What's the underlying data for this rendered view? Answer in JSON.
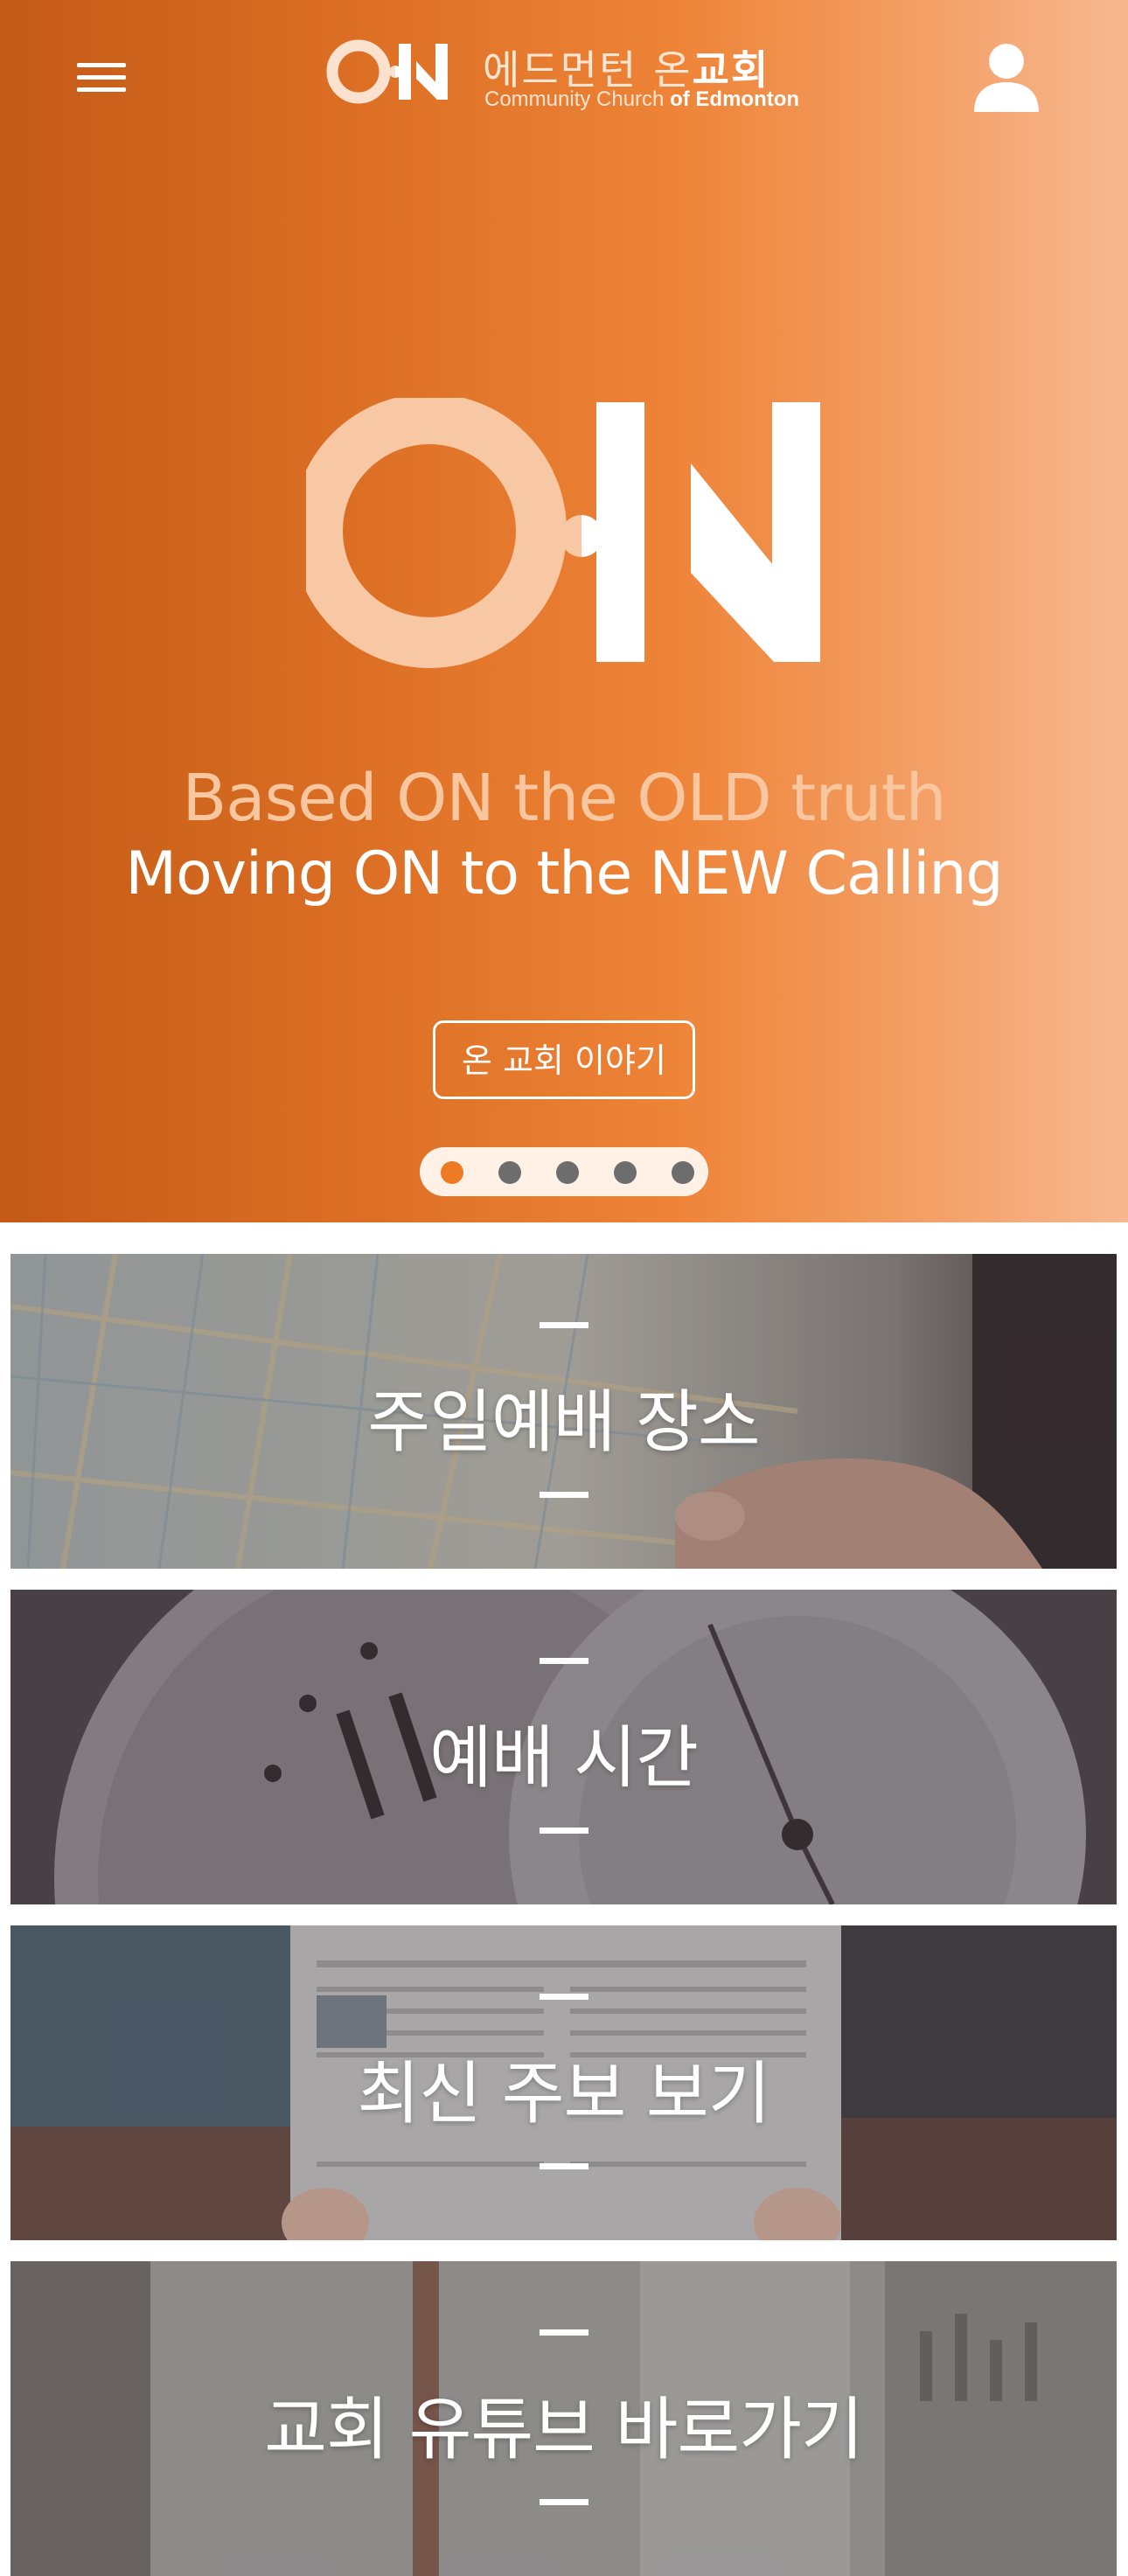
{
  "header": {
    "menu_icon": "hamburger-menu-icon",
    "user_icon": "user-profile-icon",
    "brand": {
      "mark": "ON",
      "name_kr_light": "에드먼턴",
      "name_kr_on": "온",
      "name_kr_bold": "교회",
      "name_en_light": "Community Church",
      "name_en_bold": "of Edmonton"
    }
  },
  "hero": {
    "logo_text": "ON",
    "tagline_line1": "Based ON the OLD truth",
    "tagline_line2": "Moving ON to the NEW Calling",
    "cta_label": "온 교회 이야기",
    "slides": {
      "count": 5,
      "active_index": 1
    }
  },
  "cards": [
    {
      "title": "주일예배 장소",
      "image": "city-map-photo"
    },
    {
      "title": "예배 시간",
      "image": "stopwatch-photo"
    },
    {
      "title": "최신 주보 보기",
      "image": "newspaper-photo"
    },
    {
      "title": "교회 유튜브 바로가기",
      "image": "cafe-interior-photo"
    }
  ],
  "colors": {
    "accent": "#ee7b23",
    "hero_gradient_start": "#c35a16",
    "hero_gradient_end": "#f7b891",
    "tagline_light": "#f8c7a0",
    "text_on_dark": "#ffffff",
    "dot_inactive": "#6d6d6d"
  }
}
